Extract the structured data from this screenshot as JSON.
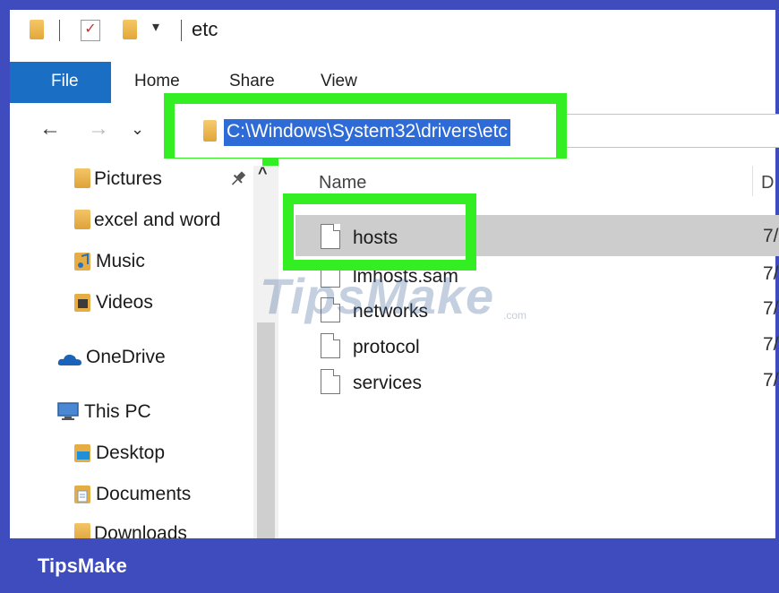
{
  "window": {
    "title": "etc"
  },
  "quick_access_toolbar": {
    "dropdown_glyph": "▾",
    "check_glyph": "✓",
    "icons": [
      "folder-icon",
      "properties-icon",
      "new-folder-icon",
      "customize-dropdown-icon"
    ]
  },
  "ribbon": {
    "tabs": [
      {
        "label": "File"
      },
      {
        "label": "Home"
      },
      {
        "label": "Share"
      },
      {
        "label": "View"
      }
    ]
  },
  "navigation": {
    "back": "←",
    "forward": "→",
    "recent": "⌄",
    "up": "↑"
  },
  "address_bar": {
    "path": "C:\\Windows\\System32\\drivers\\etc",
    "icon": "folder-icon"
  },
  "nav_pane": {
    "scroll_up_glyph": "^",
    "pin_glyph": "📌",
    "items": [
      {
        "label": "Pictures",
        "icon": "pictures-folder-icon"
      },
      {
        "label": "excel and word",
        "icon": "folder-icon"
      },
      {
        "label": "Music",
        "icon": "music-folder-icon"
      },
      {
        "label": "Videos",
        "icon": "videos-folder-icon"
      },
      {
        "label": "OneDrive",
        "icon": "onedrive-cloud-icon"
      },
      {
        "label": "This PC",
        "icon": "computer-icon"
      },
      {
        "label": "Desktop",
        "icon": "desktop-folder-icon"
      },
      {
        "label": "Documents",
        "icon": "documents-folder-icon"
      },
      {
        "label": "Downloads",
        "icon": "downloads-folder-icon"
      }
    ]
  },
  "file_list": {
    "columns": {
      "name": "Name",
      "date": "D"
    },
    "files": [
      {
        "name": "hosts",
        "date": "7/",
        "selected": true
      },
      {
        "name": "lmhosts.sam",
        "date": "7/"
      },
      {
        "name": "networks",
        "date": "7/"
      },
      {
        "name": "protocol",
        "date": "7/"
      },
      {
        "name": "services",
        "date": "7/"
      }
    ]
  },
  "watermark": {
    "text": "TipsMake",
    "suffix": ".com"
  },
  "banner": {
    "text": "TipsMake"
  },
  "colors": {
    "frame": "#3f4cbd",
    "highlight_green": "#33ee22",
    "file_tab": "#1a6fc4",
    "selection": "#2f6bd6"
  }
}
